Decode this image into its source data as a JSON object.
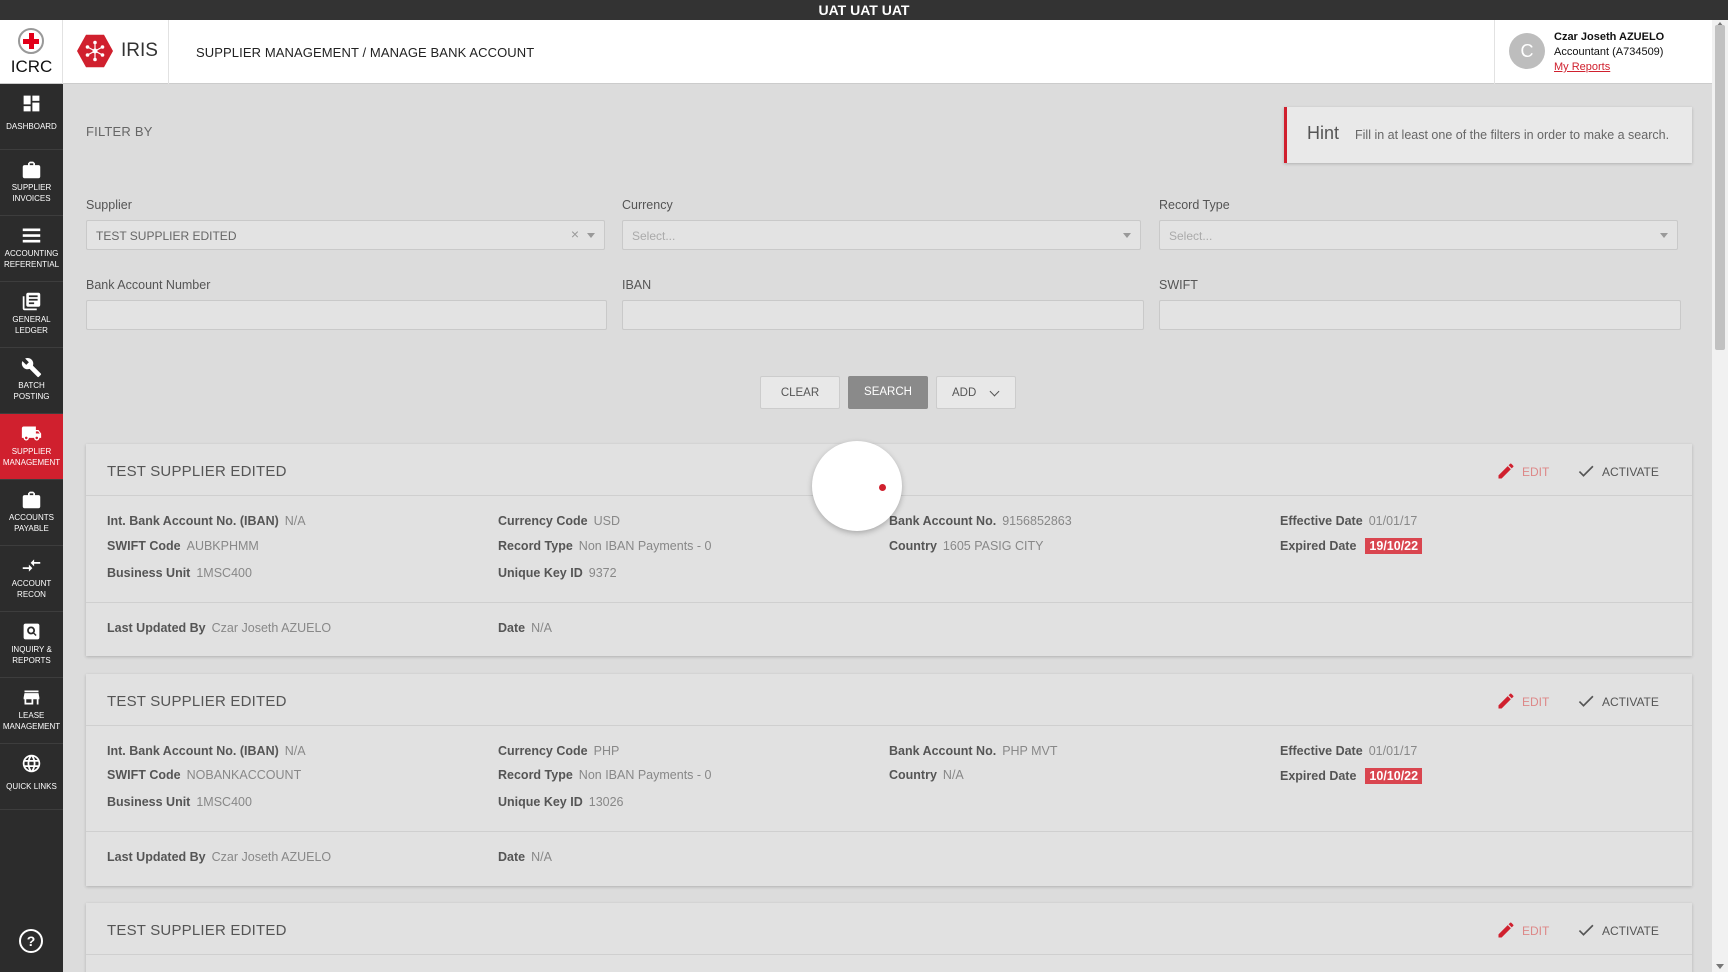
{
  "env_banner": "UAT UAT UAT",
  "header": {
    "org_name": "ICRC",
    "app_name": "IRIS",
    "breadcrumb": "SUPPLIER MANAGEMENT / MANAGE BANK ACCOUNT",
    "user": {
      "initial": "C",
      "name": "Czar Joseth AZUELO",
      "role": "Accountant (A734509)",
      "reports_link": "My Reports"
    }
  },
  "sidebar": {
    "items": [
      {
        "label": "DASHBOARD",
        "icon": "dashboard-icon"
      },
      {
        "label": "SUPPLIER INVOICES",
        "icon": "briefcase-icon"
      },
      {
        "label": "ACCOUNTING REFERENTIAL",
        "icon": "list-icon"
      },
      {
        "label": "GENERAL LEDGER",
        "icon": "ledger-icon"
      },
      {
        "label": "BATCH POSTING",
        "icon": "wrench-icon"
      },
      {
        "label": "SUPPLIER MANAGEMENT",
        "icon": "truck-icon",
        "active": true
      },
      {
        "label": "ACCOUNTS PAYABLE",
        "icon": "briefcase-icon"
      },
      {
        "label": "ACCOUNT RECON",
        "icon": "arrows-icon"
      },
      {
        "label": "INQUIRY & REPORTS",
        "icon": "magnifier-icon"
      },
      {
        "label": "LEASE MANAGEMENT",
        "icon": "building-icon"
      },
      {
        "label": "QUICK LINKS",
        "icon": "globe-icon"
      }
    ],
    "help": "?"
  },
  "filter": {
    "title": "FILTER BY",
    "hint_title": "Hint",
    "hint_text": "Fill in at least one of the filters in order to make a search.",
    "supplier_label": "Supplier",
    "supplier_value": "TEST SUPPLIER EDITED",
    "clear_symbol": "×",
    "currency_label": "Currency",
    "currency_placeholder": "Select...",
    "record_type_label": "Record Type",
    "record_type_placeholder": "Select...",
    "bank_account_label": "Bank Account Number",
    "iban_label": "IBAN",
    "swift_label": "SWIFT",
    "clear_btn": "CLEAR",
    "search_btn": "SEARCH",
    "add_btn": "ADD"
  },
  "labels": {
    "edit": "EDIT",
    "activate": "ACTIVATE",
    "iban": "Int. Bank Account No. (IBAN)",
    "swift": "SWIFT Code",
    "business_unit": "Business Unit",
    "currency_code": "Currency Code",
    "record_type": "Record Type",
    "unique_key": "Unique Key ID",
    "bank_account_no": "Bank Account No.",
    "country": "Country",
    "effective_date": "Effective Date",
    "expired_date": "Expired Date",
    "last_updated_by": "Last Updated By",
    "date": "Date"
  },
  "cards": [
    {
      "title": "TEST SUPPLIER EDITED",
      "iban": "N/A",
      "swift": "AUBKPHMM",
      "business_unit": "1MSC400",
      "currency_code": "USD",
      "record_type": "Non IBAN Payments - 0",
      "unique_key": "9372",
      "bank_account_no": "9156852863",
      "country": "1605 PASIG CITY",
      "effective_date": "01/01/17",
      "expired_date": "19/10/22",
      "last_updated_by": "Czar Joseth AZUELO",
      "date": "N/A"
    },
    {
      "title": "TEST SUPPLIER EDITED",
      "iban": "N/A",
      "swift": "NOBANKACCOUNT",
      "business_unit": "1MSC400",
      "currency_code": "PHP",
      "record_type": "Non IBAN Payments - 0",
      "unique_key": "13026",
      "bank_account_no": "PHP MVT",
      "country": "N/A",
      "effective_date": "01/01/17",
      "expired_date": "10/10/22",
      "last_updated_by": "Czar Joseth AZUELO",
      "date": "N/A"
    },
    {
      "title": "TEST SUPPLIER EDITED"
    }
  ],
  "colors": {
    "brand_red": "#d0202e",
    "expired_badge": "#d9454f",
    "sidebar_bg": "#2c2c2c"
  }
}
